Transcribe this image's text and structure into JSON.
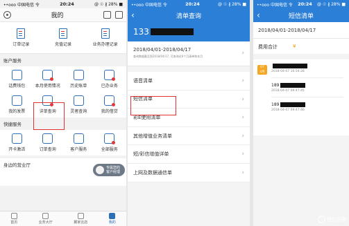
{
  "panel1": {
    "status": {
      "carrier": "••ooo 中国电信 令",
      "time": "20:24",
      "battery": "@ ☉ ∦ 28% ■"
    },
    "title": "我的",
    "top_items": [
      {
        "label": "订单记录",
        "icon": "order-record-icon"
      },
      {
        "label": "充值记录",
        "icon": "recharge-record-icon"
      },
      {
        "label": "业务办理记录",
        "icon": "service-record-icon"
      }
    ],
    "account_section": "账户服务",
    "account_items": [
      {
        "label": "话费钱包",
        "icon": "wallet-icon"
      },
      {
        "label": "本月使用情况",
        "icon": "usage-icon"
      },
      {
        "label": "历史账单",
        "icon": "history-bill-icon"
      },
      {
        "label": "已办业务",
        "icon": "done-service-icon"
      },
      {
        "label": "我的发票",
        "icon": "invoice-icon"
      },
      {
        "label": "详单查询",
        "icon": "detail-query-icon"
      },
      {
        "label": "灵者查询",
        "icon": "query-icon"
      },
      {
        "label": "我的借贷",
        "icon": "loan-icon"
      }
    ],
    "quick_section": "快捷服务",
    "quick_items": [
      {
        "label": "开卡激活",
        "icon": "activate-card-icon"
      },
      {
        "label": "订单查询",
        "icon": "order-query-icon"
      },
      {
        "label": "客户服务",
        "icon": "customer-service-icon"
      },
      {
        "label": "全部服务",
        "icon": "all-services-icon"
      }
    ],
    "nearby": "身边的营业厅",
    "manager_line1": "专属您的",
    "manager_line2": "客户经理",
    "tabs": [
      {
        "label": "首页",
        "active": false
      },
      {
        "label": "业务大厅",
        "active": false
      },
      {
        "label": "翼家云店",
        "active": false
      },
      {
        "label": "我的",
        "active": true
      }
    ]
  },
  "panel2": {
    "status": {
      "carrier": "••ooo 中国电信 令",
      "time": "20:24",
      "battery": "@ ☉ ∦ 28% ■"
    },
    "title": "清单查询",
    "phone_prefix": "133",
    "date_range": "2018/04/01-2018/04/17",
    "note": "查询数据截至到2018/04/17, 可查询近6个月清单和本月",
    "items": [
      "语音清单",
      "短信清单",
      "彩E使用清单",
      "其他增值业务清单",
      "短/彩信增值详单",
      "上网及数据通信单"
    ]
  },
  "panel3": {
    "status": {
      "carrier": "••ooo 中国电信 令",
      "time": "20:24",
      "battery": "@ ☉ ∦ 28% ■"
    },
    "title": "短信清单",
    "date_range": "2018/04/01-2018/04/17",
    "fee_label": "费用合计",
    "fee_value": "¥",
    "calendar": {
      "day": "07",
      "month": "4月"
    },
    "records": [
      {
        "prefix": "",
        "time": "2018-04-07 16:54:28"
      },
      {
        "prefix": "189",
        "time": "2018-04-07 09:47:45"
      },
      {
        "prefix": "189",
        "time": "2018-04-07 09:47:46"
      }
    ]
  },
  "watermark": "悟空问答",
  "colors": {
    "brand_blue": "#2c7fd6",
    "highlight_red": "#e03030",
    "accent_orange": "#f5a623"
  }
}
